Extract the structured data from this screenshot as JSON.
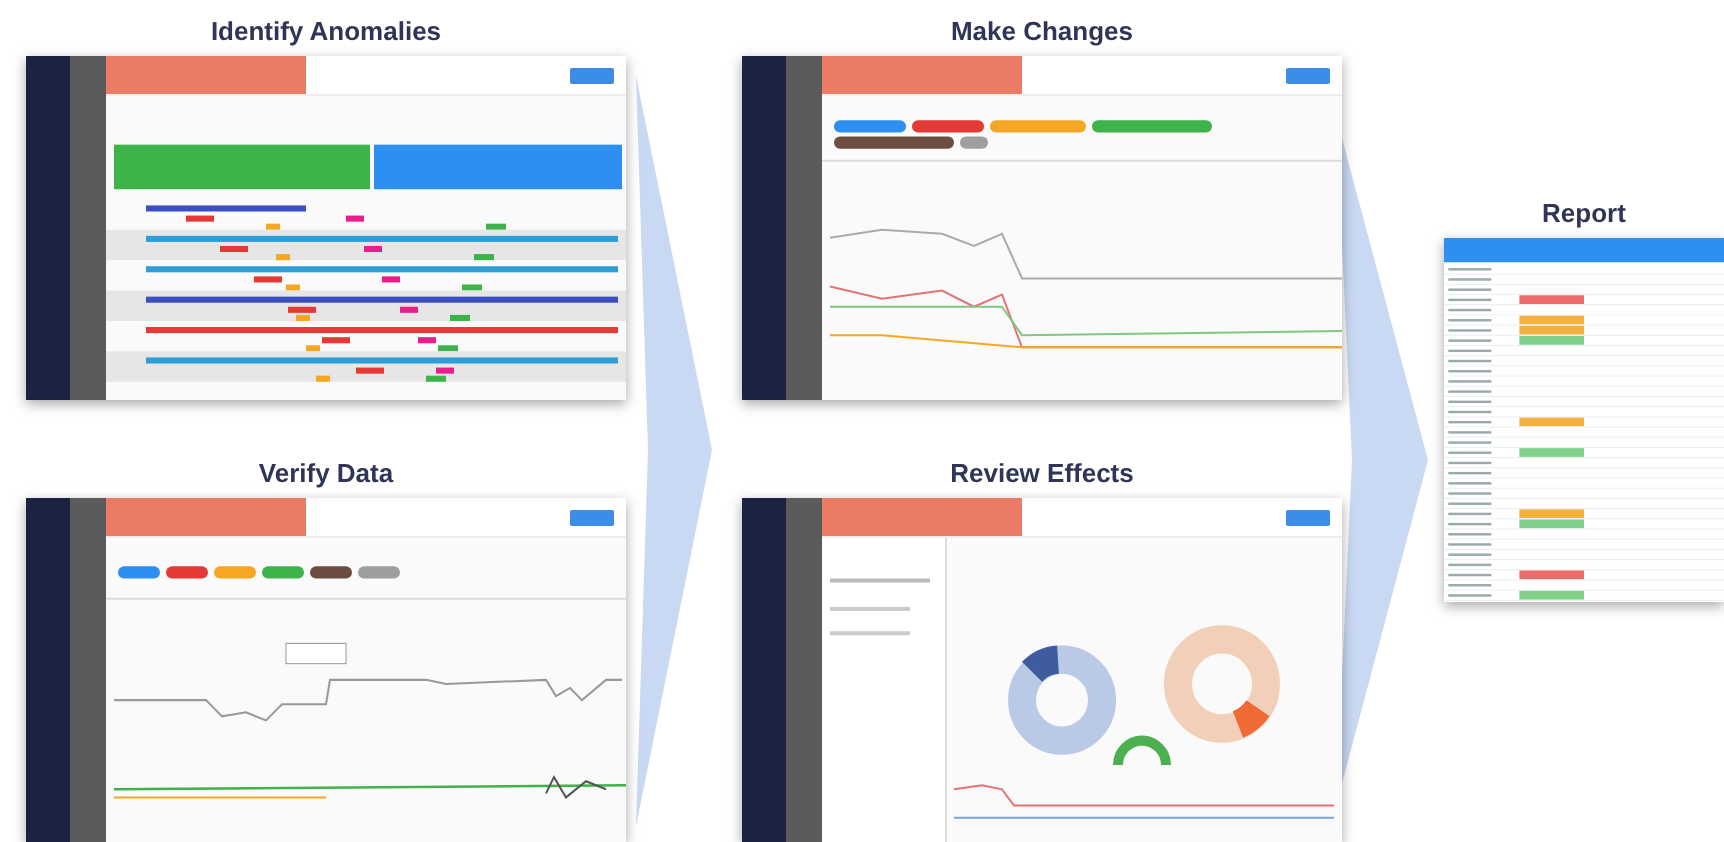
{
  "steps": [
    {
      "title": "Identify Anomalies",
      "kind": "timeline"
    },
    {
      "title": "Make Changes",
      "kind": "multitrend"
    },
    {
      "title": "Verify Data",
      "kind": "trend"
    },
    {
      "title": "Review Effects",
      "kind": "donuts"
    },
    {
      "title": "Report",
      "kind": "table"
    }
  ]
}
